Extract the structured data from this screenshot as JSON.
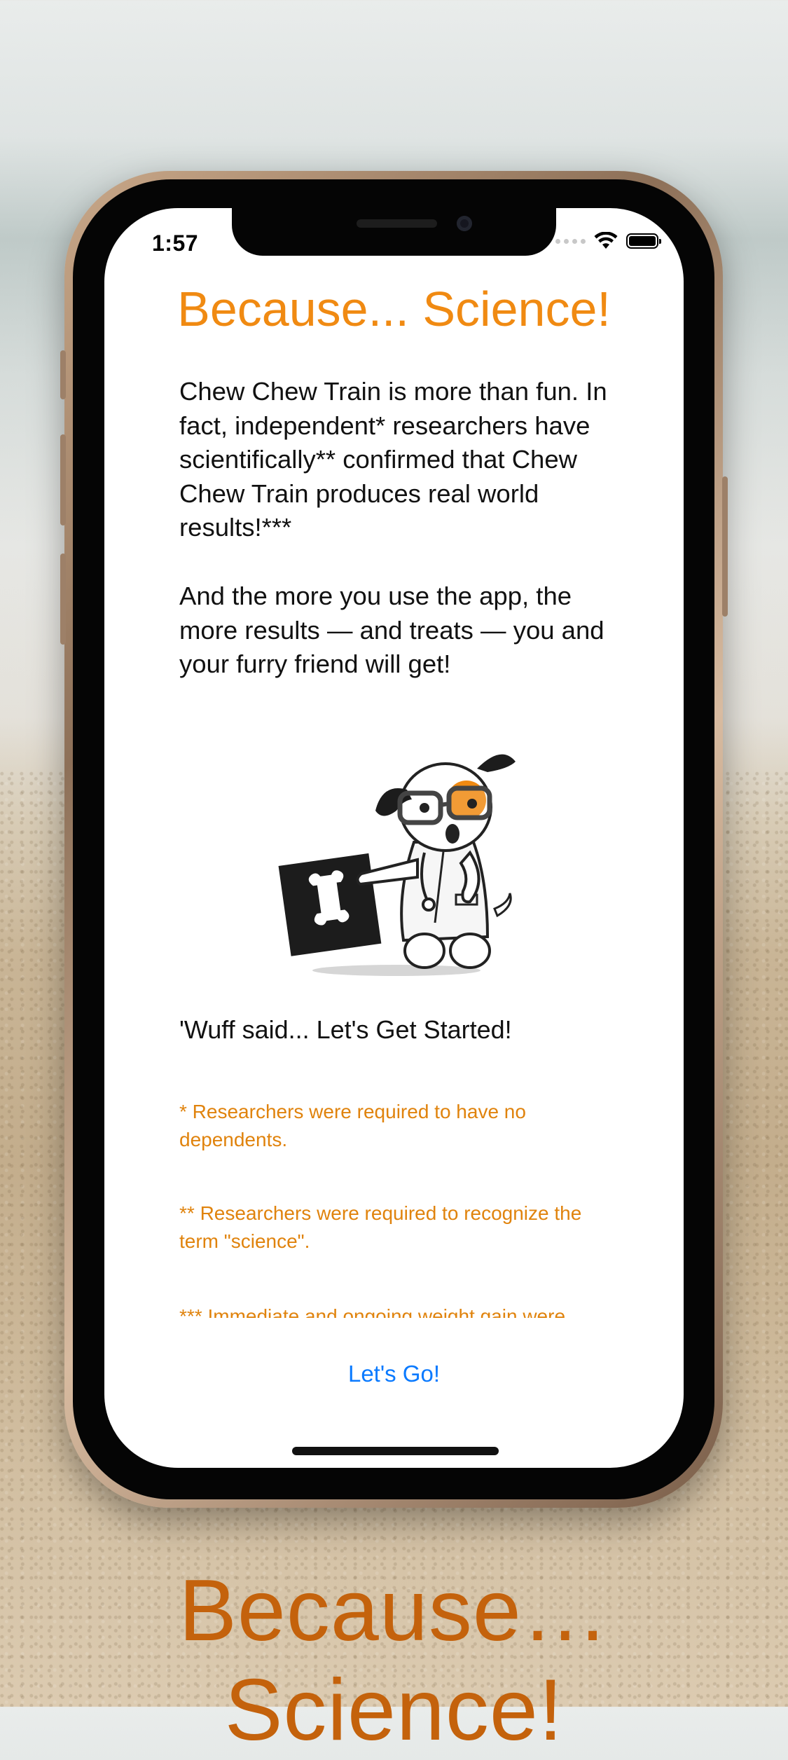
{
  "status_bar": {
    "time": "1:57"
  },
  "screen": {
    "title": "Because... Science!",
    "paragraph1": "Chew Chew Train is more than fun. In fact, independent* researchers have scientifically** confirmed that Chew Chew Train produces real world results!***",
    "paragraph2": "And the more you use the app, the more results — and treats — you and your furry friend will get!",
    "wuff_line": "'Wuff said... Let's Get Started!",
    "footnote1": "* Researchers were required to have no dependents.",
    "footnote2": "** Researchers were required to recognize the term \"science\".",
    "footnote3": "*** Immediate and ongoing weight gain were",
    "go_button": "Let's Go!"
  },
  "caption": "Because… Science!",
  "colors": {
    "accent_orange": "#f08a12",
    "footnote_orange": "#e0830d",
    "link_blue": "#0a7aff",
    "caption_orange": "#c4620c"
  },
  "icons": [
    "wifi-icon",
    "battery-icon",
    "dog-scientist-illustration"
  ]
}
